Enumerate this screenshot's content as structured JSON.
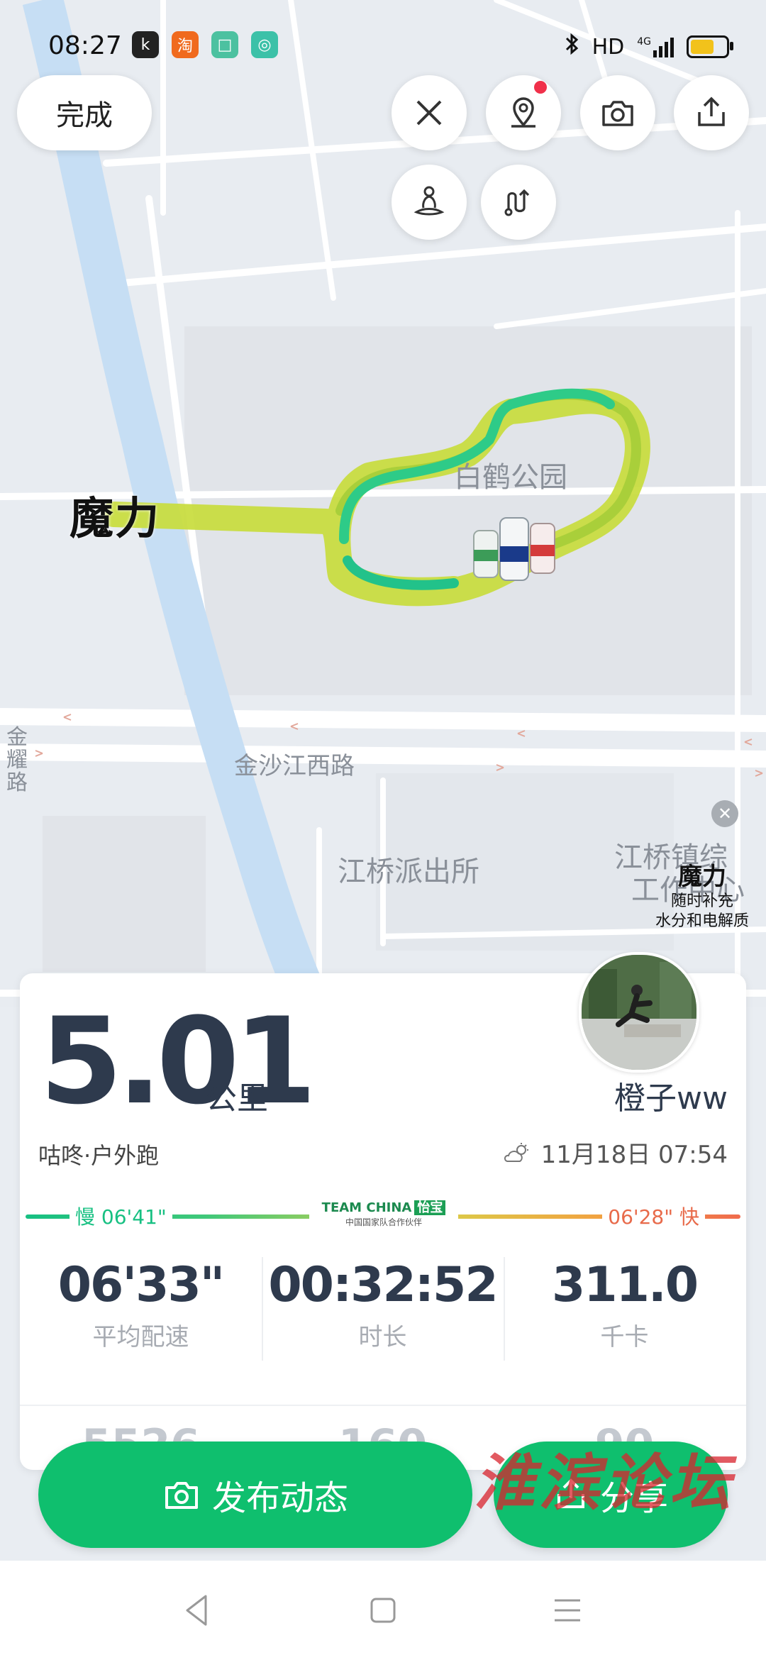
{
  "status_bar": {
    "time": "08:27",
    "app_icons": [
      "k",
      "淘",
      "□",
      "◎"
    ],
    "network": "HD",
    "network_badge": "4G"
  },
  "top_bar": {
    "done_label": "完成"
  },
  "map": {
    "park_label": "白鹤公园",
    "road_label": "金沙江西路",
    "vertical_road_label": "金耀路",
    "police_label": "江桥派出所",
    "town_label_1": "江桥镇综",
    "town_label_2": "工作中心"
  },
  "brand": {
    "name": "魔力",
    "ad_title": "魔力",
    "ad_line1": "随时补充",
    "ad_line2": "水分和电解质"
  },
  "summary": {
    "distance": "5.01",
    "distance_unit": "公里",
    "username": "橙子ww",
    "activity_type": "咕咚·户外跑",
    "datetime": "11月18日 07:54",
    "pace_slow_label": "慢 06'41\"",
    "pace_fast_label": "06'28\" 快",
    "sponsor_line1": "TEAM CHINA",
    "sponsor_badge": "怡宝",
    "sponsor_line2": "中国国家队合作伙伴",
    "stats": [
      {
        "value": "06'33\"",
        "label": "平均配速"
      },
      {
        "value": "00:32:52",
        "label": "时长"
      },
      {
        "value": "311.0",
        "label": "千卡"
      }
    ],
    "faded_row": [
      "5526",
      "160",
      "90"
    ]
  },
  "actions": {
    "post_label": "发布动态",
    "share_label": "分享"
  },
  "watermark": "淮滨论坛",
  "colors": {
    "accent_green": "#0fbf6e",
    "route_yellow": "#c8dc3c",
    "route_green": "#2ecb88",
    "text_dark": "#2e3a4d"
  },
  "icons": {
    "close": "close-icon",
    "location_pin": "location-pin-icon",
    "camera": "camera-icon",
    "share": "share-icon",
    "meditate": "person-meditate-icon",
    "route": "route-icon"
  }
}
